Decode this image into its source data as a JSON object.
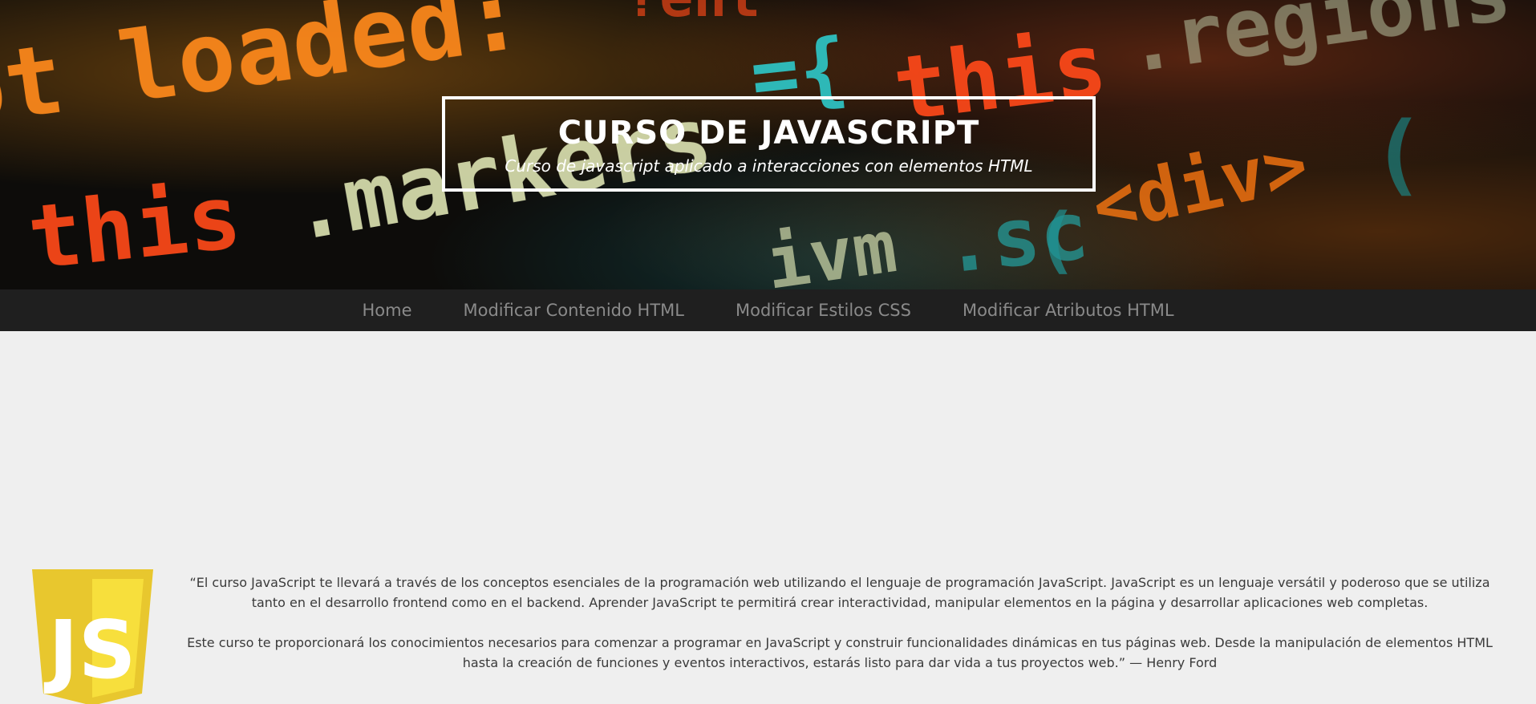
{
  "header": {
    "title": "CURSO DE JAVASCRIPT",
    "subtitle": "Curso de javascript aplicado a interacciones con elementos HTML"
  },
  "background_code_fragments": [
    "ot loaded:",
    "this",
    ".markers",
    "={",
    "this",
    ".regions",
    "(",
    "<div>",
    "ivm",
    ".sc",
    "(",
    "?ent"
  ],
  "nav": {
    "items": [
      {
        "label": "Home"
      },
      {
        "label": "Modificar Contenido HTML"
      },
      {
        "label": "Modificar Estilos CSS"
      },
      {
        "label": "Modificar Atributos HTML"
      }
    ]
  },
  "main": {
    "logo_text": "JS",
    "quote_p1": "“El curso JavaScript te llevará a través de los conceptos esenciales de la programación web utilizando el lenguaje de programación JavaScript. JavaScript es un lenguaje versátil y poderoso que se utiliza tanto en el desarrollo frontend como en el backend. Aprender JavaScript te permitirá crear interactividad, manipular elementos en la página y desarrollar aplicaciones web completas.",
    "quote_p2": "Este curso te proporcionará los conocimientos necesarios para comenzar a programar en JavaScript y construir funcionalidades dinámicas en tus páginas web. Desde la manipulación de elementos HTML hasta la creación de funciones y eventos interactivos, estarás listo para dar vida a tus proyectos web.” — Henry Ford"
  },
  "colors": {
    "nav_bg": "#1f1f1f",
    "nav_link": "#8a8a8a",
    "page_bg": "#efefef",
    "js_yellow": "#f0db4f",
    "js_yellow_dark": "#e8c72e"
  }
}
